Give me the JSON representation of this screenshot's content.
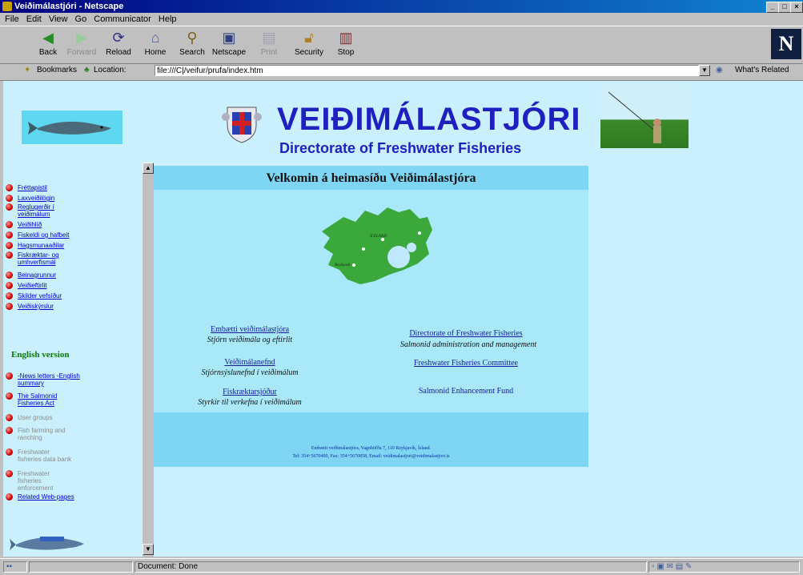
{
  "window": {
    "title": "Veiðimálastjóri - Netscape",
    "buttons": [
      "_",
      "□",
      "×"
    ]
  },
  "menu": [
    "File",
    "Edit",
    "View",
    "Go",
    "Communicator",
    "Help"
  ],
  "toolbar": {
    "buttons": [
      {
        "label": "Back",
        "icon": "back-arrow-icon",
        "enabled": true
      },
      {
        "label": "Forward",
        "icon": "forward-arrow-icon",
        "enabled": false
      },
      {
        "label": "Reload",
        "icon": "reload-icon",
        "enabled": true
      },
      {
        "label": "Home",
        "icon": "home-icon",
        "enabled": true
      },
      {
        "label": "Search",
        "icon": "search-icon",
        "enabled": true
      },
      {
        "label": "Netscape",
        "icon": "netscape-icon",
        "enabled": true
      },
      {
        "label": "Print",
        "icon": "print-icon",
        "enabled": false
      },
      {
        "label": "Security",
        "icon": "lock-icon",
        "enabled": true
      },
      {
        "label": "Stop",
        "icon": "stop-icon",
        "enabled": true
      }
    ],
    "logo": "N"
  },
  "location": {
    "bookmarks_label": "Bookmarks",
    "location_label": "Location:",
    "url": "file:///C|/veifur/prufa/index.htm",
    "related_label": "What's Related"
  },
  "sidebar": {
    "items": [
      {
        "label": "Fréttapistil"
      },
      {
        "label": "Laxveiðilögin"
      },
      {
        "label": "Reglugerðir í veiðimálum"
      },
      {
        "label": "Veiðihlíð"
      },
      {
        "label": "Fiskeldi og hafbeit"
      },
      {
        "label": "Hagsmunaaðilar"
      },
      {
        "label": "Fiskræktar- og umhverfismál"
      },
      {
        "label": "Beinagrunnur"
      },
      {
        "label": "Veiðieftirlit"
      },
      {
        "label": "Skilder vefsíður"
      },
      {
        "label": "Veiðiskýrslur"
      }
    ],
    "english_heading": "English version",
    "english_items": [
      {
        "label": "-News letters -English summary",
        "enabled": true
      },
      {
        "label": "The Salmonid Fisheries Act",
        "enabled": true
      },
      {
        "label": "User groups",
        "enabled": false
      },
      {
        "label": "Fish farming and ranching",
        "enabled": false
      },
      {
        "label": "Freshwater fisheries data bank",
        "enabled": false
      },
      {
        "label": "Freshwater fisheries enforcement",
        "enabled": false
      },
      {
        "label": "Related Web-pages",
        "enabled": true
      }
    ]
  },
  "header": {
    "title": "VEIÐIMÁLASTJÓRI",
    "subtitle": "Directorate of Freshwater Fisheries"
  },
  "main": {
    "welcome": "Velkomin á heimasíðu Veiðimálastjóra",
    "map_label": "ICELAND",
    "map_city": "Reykjavík",
    "left_col": [
      {
        "link": "Embætti veiðimálastjóra",
        "desc": "Stjórn veiðimála og eftirlit"
      },
      {
        "link": "Veiðimálanefnd",
        "desc": "Stjórnsýslunefnd í veiðimálum"
      },
      {
        "link": "Fiskræktarsjóður",
        "desc": "Styrkir til verkefna í veiðimálum"
      }
    ],
    "right_col": [
      {
        "link": "Directorate of Freshwater Fisheries",
        "desc": "Salmonid administration and management"
      },
      {
        "link": "Freshwater Fisheries Committee"
      },
      {
        "plain": "Salmonid Enhancement Fund"
      }
    ],
    "footer_line1": "Embætti veiðimálastjóra, Vagnhöfða 7, 110 Reykjavík, Ísland.",
    "footer_line2": "Tel: 354+5670400, Fax: 354+5670858, Email: veidimalastjori@veidimalastjori.is"
  },
  "status": {
    "text": "Document: Done"
  }
}
